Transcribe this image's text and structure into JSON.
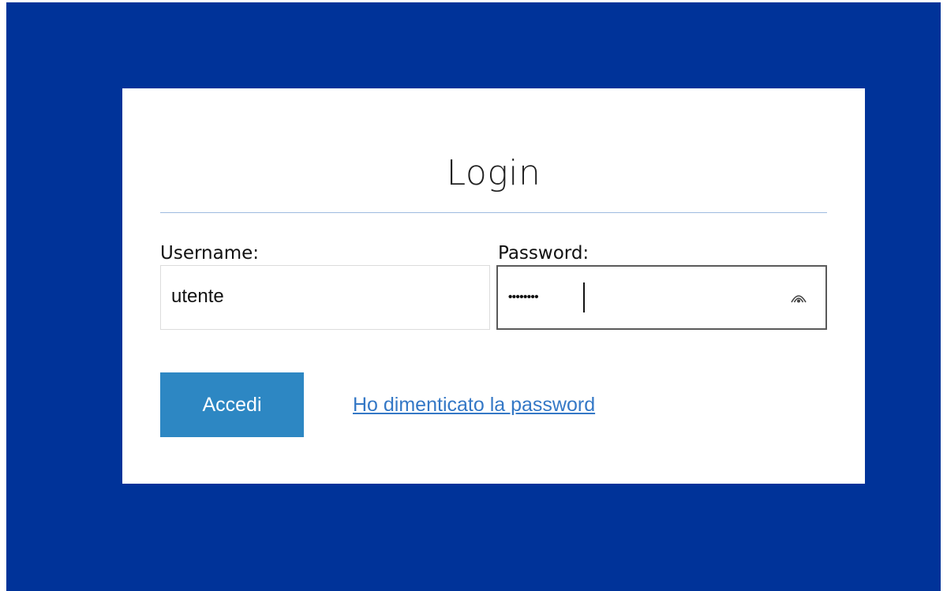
{
  "login": {
    "title": "Login",
    "username_label": "Username:",
    "username_value": "utente",
    "password_label": "Password:",
    "password_mask": "••••••••",
    "submit_label": "Accedi",
    "forgot_link_label": "Ho dimenticato la password"
  },
  "icons": {
    "reveal": "reveal-password-icon"
  },
  "colors": {
    "page_background": "#003399",
    "card_background": "#ffffff",
    "divider": "#9dbbe0",
    "button_background": "#2d87c3",
    "link": "#3478c6"
  }
}
